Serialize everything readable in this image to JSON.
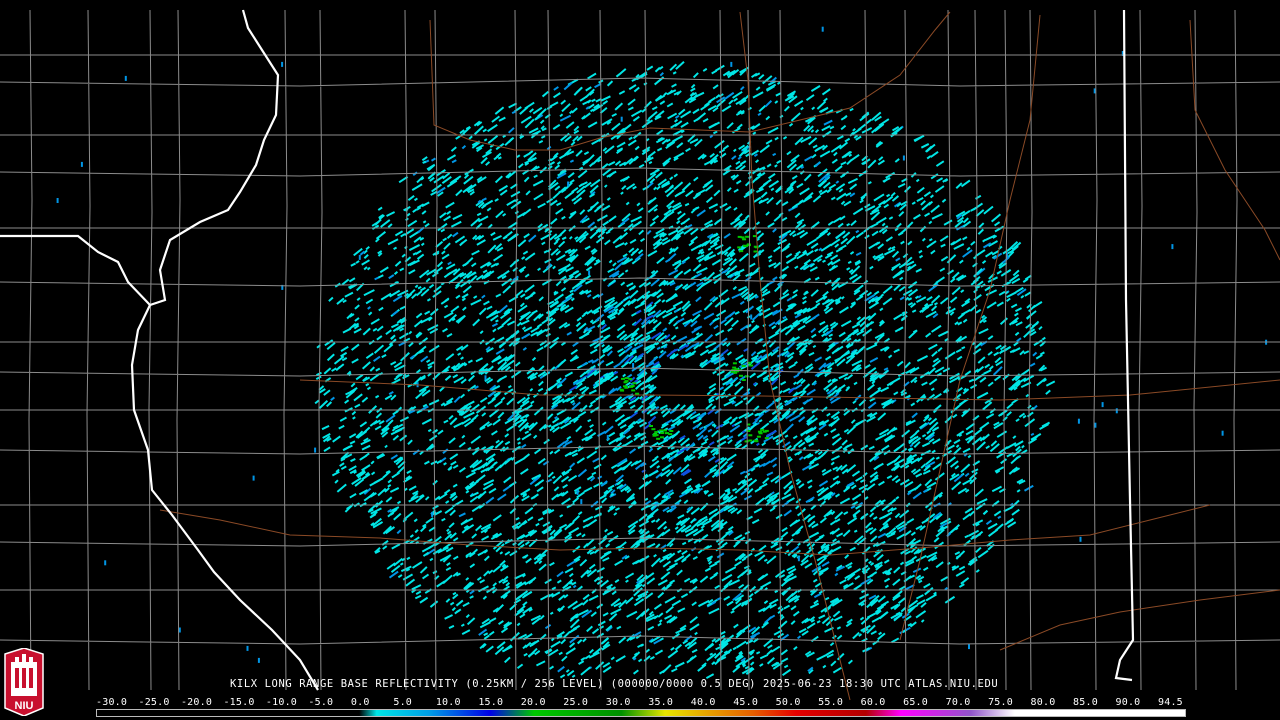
{
  "product": {
    "caption": "KILX LONG RANGE BASE REFLECTIVITY (0.25KM / 256 LEVEL) (000000/0000 0.5 DEG) 2025-06-23 18:30 UTC  ATLAS.NIU.EDU"
  },
  "logo": {
    "text": "NIU"
  },
  "color_scale": {
    "labels": [
      "-30.0",
      "-25.0",
      "-20.0",
      "-15.0",
      "-10.0",
      "-5.0",
      "0.0",
      "5.0",
      "10.0",
      "15.0",
      "20.0",
      "25.0",
      "30.0",
      "35.0",
      "40.0",
      "45.0",
      "50.0",
      "55.0",
      "60.0",
      "65.0",
      "70.0",
      "75.0",
      "80.0",
      "85.0",
      "90.0",
      "94.5"
    ],
    "stops": [
      {
        "dbz": -30,
        "color": "#000000"
      },
      {
        "dbz": 0,
        "color": "#000000"
      },
      {
        "dbz": 2,
        "color": "#00e6e6"
      },
      {
        "dbz": 8,
        "color": "#009ee6"
      },
      {
        "dbz": 15,
        "color": "#0000e6"
      },
      {
        "dbz": 20,
        "color": "#00c800"
      },
      {
        "dbz": 30,
        "color": "#009000"
      },
      {
        "dbz": 35,
        "color": "#e6e600"
      },
      {
        "dbz": 40,
        "color": "#e6a000"
      },
      {
        "dbz": 45,
        "color": "#e66000"
      },
      {
        "dbz": 50,
        "color": "#e60000"
      },
      {
        "dbz": 58,
        "color": "#b40000"
      },
      {
        "dbz": 62,
        "color": "#ff00ff"
      },
      {
        "dbz": 70,
        "color": "#9055c8"
      },
      {
        "dbz": 75,
        "color": "#ffffff"
      },
      {
        "dbz": 94.5,
        "color": "#ffffff"
      }
    ]
  },
  "echo_colors": {
    "light": "#00e6e6",
    "medium": "#0096e6",
    "heavy": "#1050e0",
    "green": "#00c800"
  },
  "map_colors": {
    "county_lines": "#8c8c8c",
    "state_lines": "#ffffff",
    "highways": "#8b4a26"
  }
}
